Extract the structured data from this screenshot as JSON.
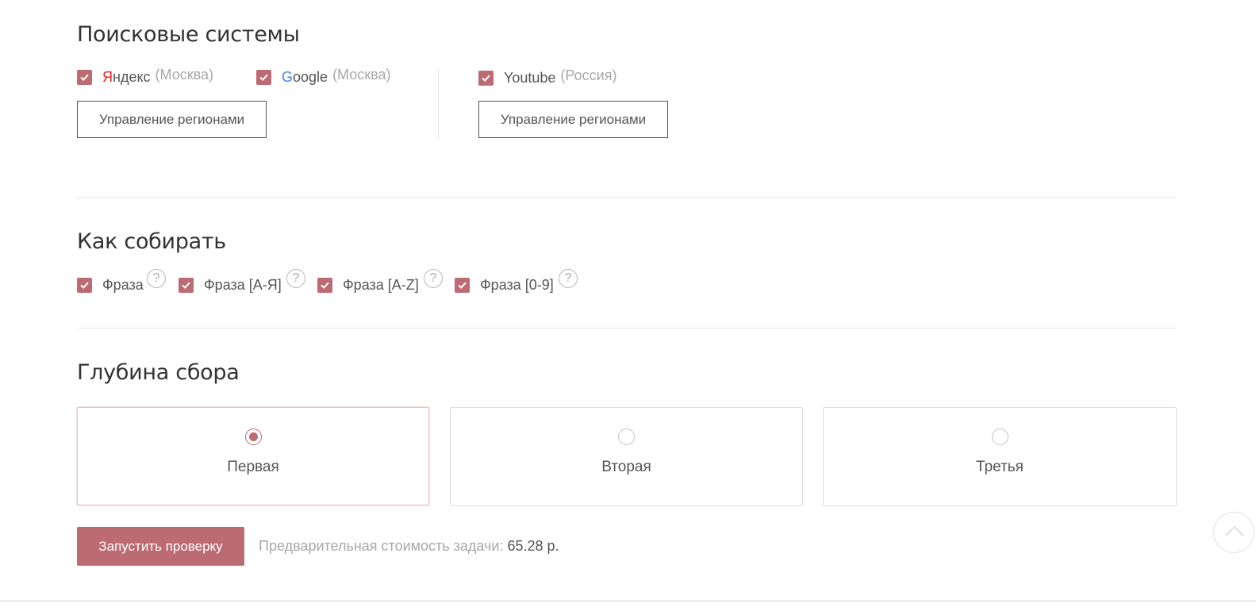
{
  "search_engines": {
    "title": "Поисковые системы",
    "yandex": {
      "first_letter": "Я",
      "rest": "ндекс",
      "region": "(Москва)",
      "checked": true
    },
    "google": {
      "first_letter": "G",
      "rest": "oogle",
      "region": "(Москва)",
      "checked": true
    },
    "youtube": {
      "label": "Youtube",
      "region": "(Россия)",
      "checked": true
    },
    "manage_regions_label": "Управление регионами",
    "manage_regions_label_2": "Управление регионами"
  },
  "how_to_collect": {
    "title": "Как собирать",
    "options": [
      {
        "label": "Фраза",
        "checked": true
      },
      {
        "label": "Фраза [А-Я]",
        "checked": true
      },
      {
        "label": "Фраза [A-Z]",
        "checked": true
      },
      {
        "label": "Фраза [0-9]",
        "checked": true
      }
    ],
    "help_glyph": "?"
  },
  "depth": {
    "title": "Глубина сбора",
    "options": [
      {
        "label": "Первая",
        "selected": true
      },
      {
        "label": "Вторая",
        "selected": false
      },
      {
        "label": "Третья",
        "selected": false
      }
    ]
  },
  "footer": {
    "run_button": "Запустить проверку",
    "cost_label": "Предварительная стоимость задачи:",
    "cost_value": "65.28 р."
  },
  "colors": {
    "accent": "#bd6b73",
    "yandex_red": "#e0251b",
    "google_blue": "#4285f4",
    "selected_border": "#f1b9bf"
  },
  "icons": [
    "check-icon",
    "help-icon",
    "radio-icon",
    "chevron-up-icon"
  ]
}
